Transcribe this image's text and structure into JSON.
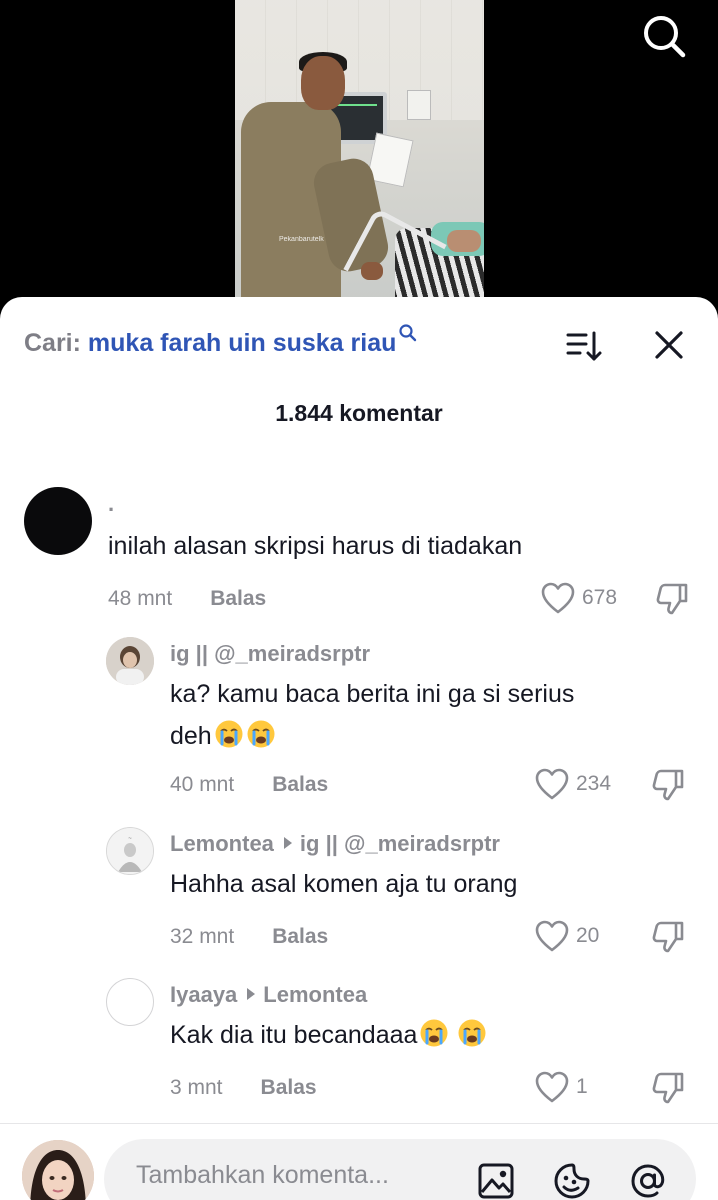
{
  "video": {
    "watermark": "Pekanbarutelk"
  },
  "search_bar": {
    "label": "Cari:",
    "query": "muka farah uin suska riau"
  },
  "comments_count": "1.844 komentar",
  "comments": [
    {
      "username": ".",
      "reply_to": "",
      "text": "inilah alasan skripsi harus di tiadakan",
      "time": "48 mnt",
      "reply_label": "Balas",
      "likes": "678"
    },
    {
      "username": "ig || @_meiradsrptr",
      "reply_to": "",
      "text_line1": "ka? kamu baca berita ini ga si serius",
      "text_line2": "deh",
      "time": "40 mnt",
      "reply_label": "Balas",
      "likes": "234"
    },
    {
      "username": "Lemontea",
      "reply_to": "ig || @_meiradsrptr",
      "text": "Hahha asal komen aja tu orang",
      "time": "32 mnt",
      "reply_label": "Balas",
      "likes": "20"
    },
    {
      "username": "Iyaaya",
      "reply_to": "Lemontea",
      "text": "Kak dia itu becandaaa",
      "time": "3 mnt",
      "reply_label": "Balas",
      "likes": "1"
    }
  ],
  "input": {
    "placeholder": "Tambahkan komenta..."
  },
  "icons": {
    "search": "search-icon",
    "sort": "sort-icon",
    "close": "close-icon",
    "heart": "heart-icon",
    "dislike": "dislike-icon",
    "image": "image-icon",
    "emoji": "emoji-icon",
    "mention": "mention-icon",
    "crying": "crying-face-emoji"
  },
  "colors": {
    "query": "#2f55b5",
    "muted": "#8a8b91",
    "text": "#161823"
  }
}
